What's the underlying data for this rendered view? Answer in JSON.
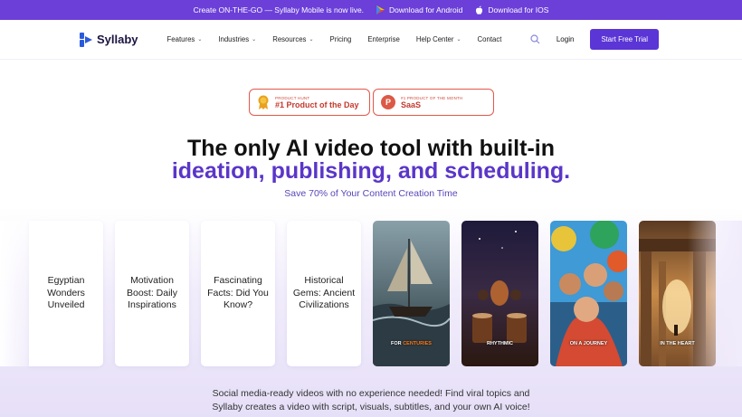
{
  "banner": {
    "text": "Create ON-THE-GO — Syllaby Mobile is now live.",
    "android_label": "Download for Android",
    "ios_label": "Download for IOS"
  },
  "nav": {
    "logo": "Syllaby",
    "items": [
      {
        "label": "Features",
        "dropdown": true
      },
      {
        "label": "Industries",
        "dropdown": true
      },
      {
        "label": "Resources",
        "dropdown": true
      },
      {
        "label": "Pricing",
        "dropdown": false
      },
      {
        "label": "Enterprise",
        "dropdown": false
      },
      {
        "label": "Help Center",
        "dropdown": true
      },
      {
        "label": "Contact",
        "dropdown": false
      }
    ],
    "login": "Login",
    "cta": "Start Free Trial"
  },
  "badges": [
    {
      "small": "PRODUCT HUNT",
      "big": "#1 Product of the Day"
    },
    {
      "small": "#1 PRODUCT OF THE MONTH",
      "big": "SaaS"
    }
  ],
  "hero": {
    "line1": "The only AI video tool with built-in",
    "line2": "ideation, publishing, and scheduling.",
    "subtitle": "Save 70% of Your Content Creation Time"
  },
  "cards": [
    "Egyptian Wonders Unveiled",
    "Motivation Boost: Daily Inspirations",
    "Fascinating Facts: Did You Know?",
    "Historical Gems: Ancient Civilizations"
  ],
  "thumbnails": [
    {
      "caption_white": "FOR",
      "caption_orange": "CENTURIES"
    },
    {
      "caption_white": "RHYTHMIC",
      "caption_orange": ""
    },
    {
      "caption_white": "ON A JOURNEY",
      "caption_orange": ""
    },
    {
      "caption_white": "IN THE HEART",
      "caption_orange": ""
    }
  ],
  "bottom": {
    "line1": "Social media-ready videos with no experience needed! Find viral topics and",
    "line2": "Syllaby creates a video with script, visuals, subtitles, and your own AI voice!"
  },
  "colors": {
    "brand": "#5b35d5",
    "banner": "#6b3fd8",
    "badge": "#e4574a"
  }
}
